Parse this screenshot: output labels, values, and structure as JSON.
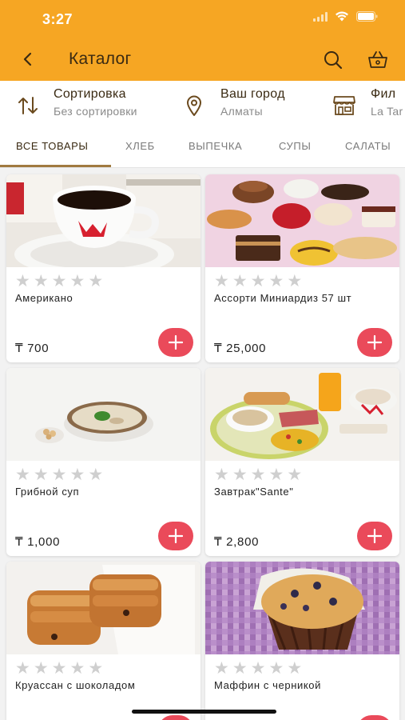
{
  "status": {
    "time": "3:27"
  },
  "nav": {
    "title": "Каталог"
  },
  "filters": [
    {
      "title": "Сортировка",
      "subtitle": "Без сортировки",
      "icon": "sort-icon"
    },
    {
      "title": "Ваш город",
      "subtitle": "Алматы",
      "icon": "location-pin-icon"
    },
    {
      "title": "Фил",
      "subtitle": "La Tar",
      "icon": "store-icon"
    }
  ],
  "tabs": [
    "ВСЕ ТОВАРЫ",
    "ХЛЕБ",
    "ВЫПЕЧКА",
    "СУПЫ",
    "САЛАТЫ"
  ],
  "products": [
    {
      "name": "Американо",
      "price": "₸ 700",
      "rating": 0
    },
    {
      "name": "Ассорти Миниардиз 57 шт",
      "price": "₸ 25,000",
      "rating": 0
    },
    {
      "name": "Грибной суп",
      "price": "₸ 1,000",
      "rating": 0
    },
    {
      "name": "Завтрак\"Sante\"",
      "price": "₸ 2,800",
      "rating": 0
    },
    {
      "name": "Круассан с шоколадом",
      "price": "",
      "rating": 0
    },
    {
      "name": "Маффин с черникой",
      "price": "",
      "rating": 0
    }
  ],
  "colors": {
    "header": "#f6a623",
    "accent": "#ea4a5a",
    "tab_underline": "#a07a40"
  }
}
